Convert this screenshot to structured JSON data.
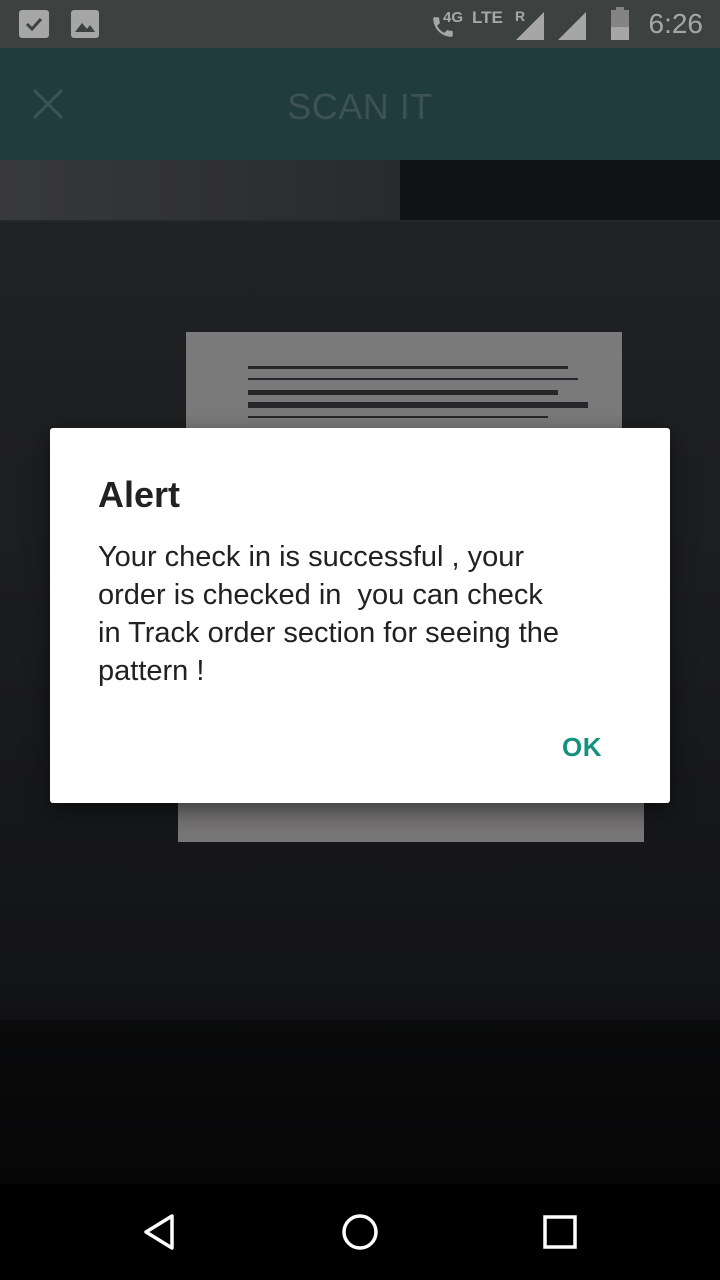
{
  "status_bar": {
    "network_4g": "4G",
    "network_lte": "LTE",
    "roaming": "R",
    "time": "6:26",
    "icons": [
      "check-notification-icon",
      "image-notification-icon",
      "call-icon",
      "signal-icon",
      "signal-icon-2",
      "battery-icon"
    ]
  },
  "toolbar": {
    "title": "SCAN IT",
    "close_icon": "close-icon"
  },
  "dialog": {
    "title": "Alert",
    "message": "Your check in is successful , your\norder is checked in  you can check\nin Track order section for seeing the\npattern !",
    "ok_label": "OK",
    "accent_color": "#12927f"
  },
  "nav_bar": {
    "icons": [
      "back-icon",
      "home-icon",
      "recents-icon"
    ]
  },
  "colors": {
    "toolbar": "#345c5e",
    "status_bar": "#5f6664"
  }
}
